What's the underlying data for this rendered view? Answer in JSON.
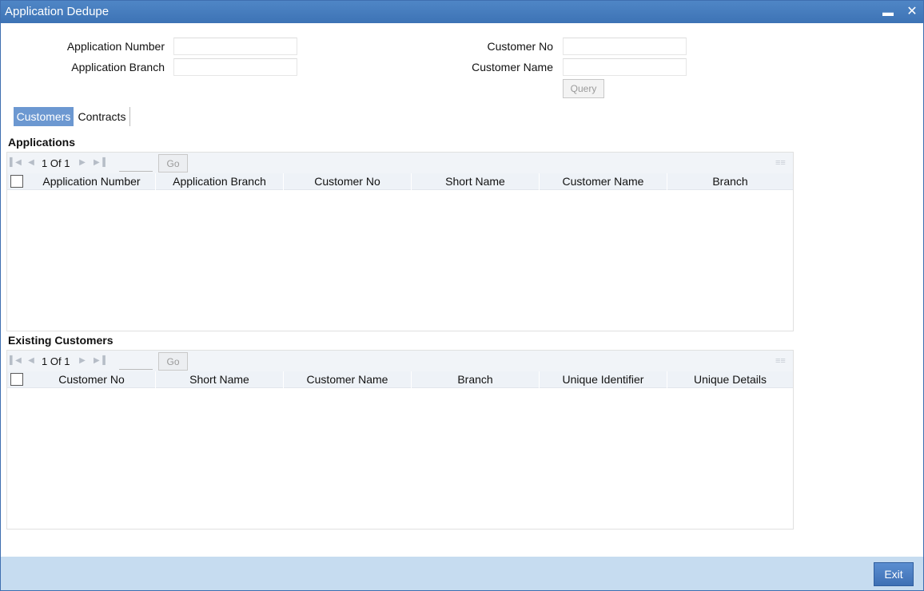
{
  "window": {
    "title": "Application Dedupe",
    "minimize_icon": "minimize-icon",
    "close_icon": "close-icon"
  },
  "form": {
    "application_number_label": "Application Number",
    "application_number_value": "",
    "application_branch_label": "Application Branch",
    "application_branch_value": "",
    "customer_no_label": "Customer No",
    "customer_no_value": "",
    "customer_name_label": "Customer Name",
    "customer_name_value": "",
    "query_label": "Query"
  },
  "tabs": [
    {
      "label": "Customers",
      "active": true
    },
    {
      "label": "Contracts",
      "active": false
    }
  ],
  "applications": {
    "title": "Applications",
    "pager": {
      "current": "1",
      "of_label": "Of",
      "total": "1",
      "go_label": "Go",
      "page_value": ""
    },
    "columns": [
      "Application Number",
      "Application Branch",
      "Customer No",
      "Short Name",
      "Customer Name",
      "Branch"
    ],
    "rows": []
  },
  "existing_customers": {
    "title": "Existing Customers",
    "pager": {
      "current": "1",
      "of_label": "Of",
      "total": "1",
      "go_label": "Go",
      "page_value": ""
    },
    "columns": [
      "Customer No",
      "Short Name",
      "Customer Name",
      "Branch",
      "Unique Identifier",
      "Unique Details"
    ],
    "rows": []
  },
  "footer": {
    "exit_label": "Exit"
  },
  "colors": {
    "titlebar": "#3d73b5",
    "active_tab": "#6c98d1",
    "footer": "#c6dcf0",
    "exit_button": "#3e70b4"
  }
}
